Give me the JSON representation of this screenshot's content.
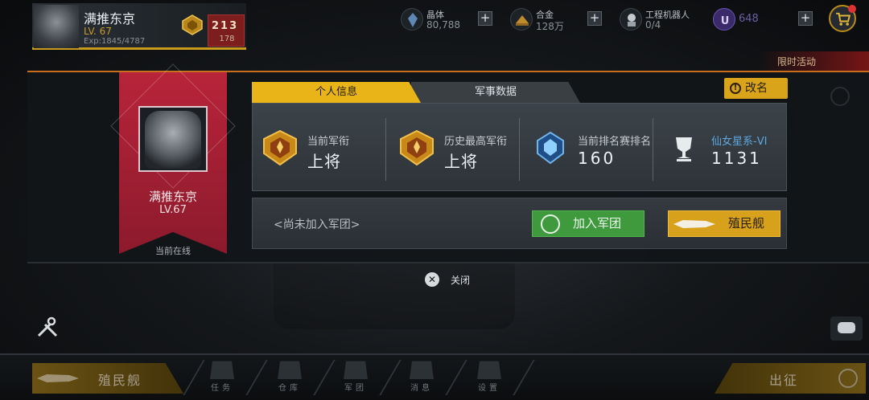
{
  "player": {
    "name": "满推东京",
    "level": "LV. 67",
    "exp": "Exp:1845/4787",
    "rank_digits": "213",
    "rank_number": "178"
  },
  "resources": [
    {
      "name": "晶体",
      "value": "80,788",
      "icon": "crystal-icon"
    },
    {
      "name": "合金",
      "value": "128万",
      "icon": "alloy-icon"
    },
    {
      "name": "工程机器人",
      "value": "0/4",
      "icon": "robot-icon"
    },
    {
      "name": "",
      "value": "648",
      "icon": "u-coin-icon"
    }
  ],
  "event_tab": "限时活动",
  "profile": {
    "name": "满推东京",
    "level": "LV.67",
    "status": "当前在线"
  },
  "tabs": {
    "personal": "个人信息",
    "military": "军事数据"
  },
  "rename_label": "改名",
  "stats": [
    {
      "label": "当前军衔",
      "value": "上将",
      "icon": "rank-medal-icon"
    },
    {
      "label": "历史最高军衔",
      "value": "上将",
      "icon": "rank-medal-icon"
    },
    {
      "label": "当前排名赛排名",
      "value": "160",
      "icon": "ranking-crystal-icon"
    },
    {
      "label": "仙女星系-VI",
      "value": "1131",
      "icon": "trophy-icon"
    }
  ],
  "legion": {
    "status": "<尚未加入军团>",
    "join_label": "加入军团",
    "colony_label": "殖民舰"
  },
  "close_label": "关闭",
  "bottom": {
    "colony_label": "殖民舰",
    "deploy_label": "出征",
    "nav": [
      "任务",
      "仓库",
      "军团",
      "消息",
      "设置"
    ]
  },
  "colors": {
    "accent_gold": "#e9b417",
    "banner_red": "#b8243a",
    "join_green": "#3e9a3c",
    "link_blue": "#5fa8dd"
  }
}
